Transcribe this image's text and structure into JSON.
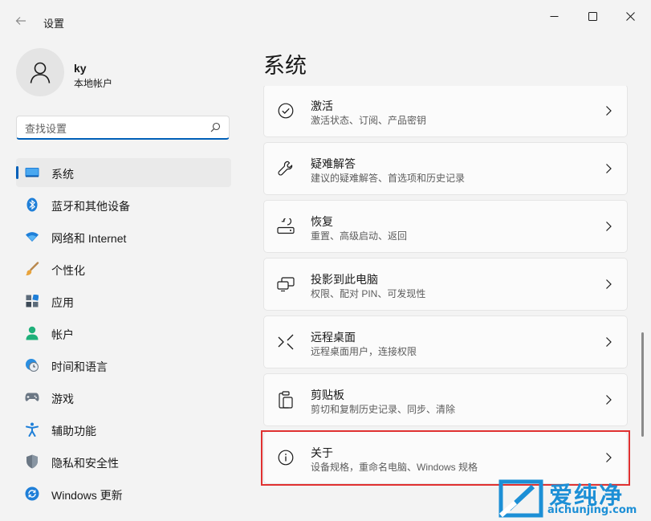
{
  "window": {
    "title": "设置",
    "back_icon": "back-arrow-icon",
    "controls": [
      "minimize-icon",
      "maximize-icon",
      "close-icon"
    ]
  },
  "user": {
    "name": "ky",
    "account_type": "本地帐户",
    "avatar_icon": "person-icon"
  },
  "search": {
    "value": "",
    "placeholder": "查找设置",
    "icon": "search-icon"
  },
  "sidebar": {
    "items": [
      {
        "label": "系统",
        "icon": "system-icon",
        "active": true
      },
      {
        "label": "蓝牙和其他设备",
        "icon": "bluetooth-icon"
      },
      {
        "label": "网络和 Internet",
        "icon": "wifi-icon"
      },
      {
        "label": "个性化",
        "icon": "brush-icon"
      },
      {
        "label": "应用",
        "icon": "apps-icon"
      },
      {
        "label": "帐户",
        "icon": "account-icon"
      },
      {
        "label": "时间和语言",
        "icon": "globe-clock-icon"
      },
      {
        "label": "游戏",
        "icon": "gamepad-icon"
      },
      {
        "label": "辅助功能",
        "icon": "accessibility-icon"
      },
      {
        "label": "隐私和安全性",
        "icon": "shield-icon"
      },
      {
        "label": "Windows 更新",
        "icon": "windows-update-icon"
      }
    ]
  },
  "main": {
    "page_title": "系统",
    "items": [
      {
        "title": "激活",
        "subtitle": "激活状态、订阅、产品密钥",
        "icon": "check-circle-icon"
      },
      {
        "title": "疑难解答",
        "subtitle": "建议的疑难解答、首选项和历史记录",
        "icon": "wrench-icon"
      },
      {
        "title": "恢复",
        "subtitle": "重置、高级启动、返回",
        "icon": "recovery-icon"
      },
      {
        "title": "投影到此电脑",
        "subtitle": "权限、配对 PIN、可发现性",
        "icon": "projection-icon"
      },
      {
        "title": "远程桌面",
        "subtitle": "远程桌面用户，连接权限",
        "icon": "remote-desktop-icon"
      },
      {
        "title": "剪贴板",
        "subtitle": "剪切和复制历史记录、同步、清除",
        "icon": "clipboard-icon"
      },
      {
        "title": "关于",
        "subtitle": "设备规格，重命名电脑、Windows 规格",
        "icon": "info-icon",
        "highlighted": true
      }
    ]
  },
  "watermark": {
    "text": "爱纯净",
    "url": "aichunjing.com"
  },
  "colors": {
    "accent": "#005fb8",
    "highlight": "#e03131",
    "background": "#f3f3f3",
    "card": "#fbfbfb",
    "watermark": "#1c8fd6"
  }
}
